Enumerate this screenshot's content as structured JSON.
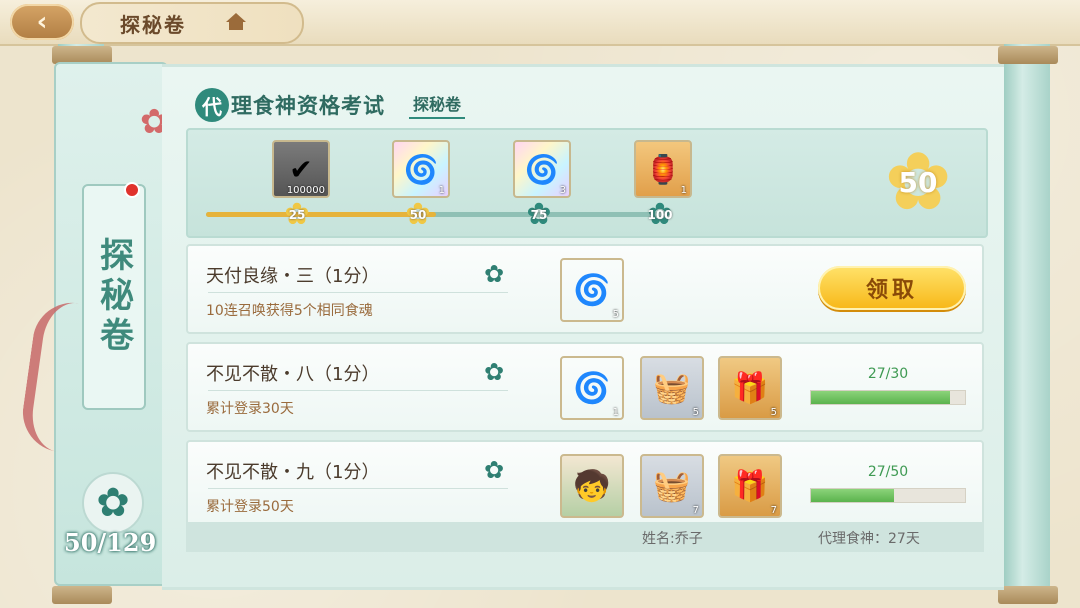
{
  "header": {
    "title": "探秘卷",
    "back_icon": "‹",
    "home_icon": "home-icon"
  },
  "left": {
    "label": "探秘卷",
    "progress": "50/129",
    "flower_icon": "✿"
  },
  "panel": {
    "title_first": "代",
    "title_rest": "理食神资格考试",
    "subtitle": "探秘卷"
  },
  "milestones": {
    "current_score": "50",
    "progress_fraction": 0.5,
    "nodes": [
      {
        "label": "25",
        "reached": true
      },
      {
        "label": "50",
        "reached": true
      },
      {
        "label": "75",
        "reached": false
      },
      {
        "label": "100",
        "reached": false
      }
    ],
    "rewards": [
      {
        "icon": "✔",
        "count": "100000",
        "style": "grey"
      },
      {
        "icon": "🌀",
        "count": "1",
        "style": "rainbow"
      },
      {
        "icon": "🌀",
        "count": "3",
        "style": "rainbow"
      },
      {
        "icon": "🏮",
        "count": "1",
        "style": "red"
      }
    ]
  },
  "tasks": [
    {
      "title": "天付良缘・三（1分）",
      "desc": "10连召唤获得5个相同食魂",
      "items": [
        {
          "icon": "🌀",
          "count": "5",
          "style": "rainbow"
        }
      ],
      "claim_label": "领取"
    },
    {
      "title": "不见不散・八（1分）",
      "desc": "累计登录30天",
      "items": [
        {
          "icon": "🌀",
          "count": "1",
          "style": "rainbow"
        },
        {
          "icon": "🧺",
          "count": "5",
          "style": "box"
        },
        {
          "icon": "🎁",
          "count": "5",
          "style": "redbox"
        }
      ],
      "progress_current": "27",
      "progress_total": "/30",
      "progress_fraction": 0.9
    },
    {
      "title": "不见不散・九（1分）",
      "desc": "累计登录50天",
      "items": [
        {
          "icon": "🧒",
          "count": "",
          "style": "avatar"
        },
        {
          "icon": "🧺",
          "count": "7",
          "style": "box"
        },
        {
          "icon": "🎁",
          "count": "7",
          "style": "redbox"
        }
      ],
      "progress_current": "27",
      "progress_total": "/50",
      "progress_fraction": 0.54
    }
  ],
  "footer": {
    "name": "姓名:乔子",
    "days": "代理食神：27天"
  },
  "colors": {
    "accent": "#2f8a7c",
    "gold": "#e6b33b",
    "progress_green": "#5ab34d"
  }
}
